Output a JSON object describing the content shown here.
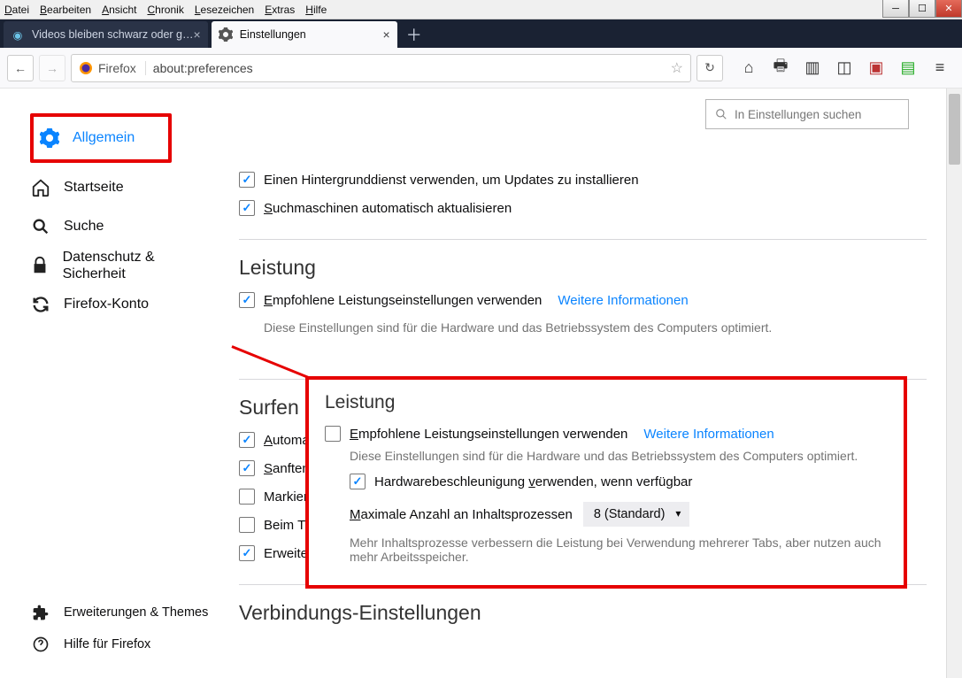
{
  "menubar": [
    "Datei",
    "Bearbeiten",
    "Ansicht",
    "Chronik",
    "Lesezeichen",
    "Extras",
    "Hilfe"
  ],
  "tabs": [
    {
      "title": "Videos bleiben schwarz oder g…",
      "favicon_color": "#2aa3c9"
    },
    {
      "title": "Einstellungen",
      "favicon_color": "#555"
    }
  ],
  "url": {
    "identity": "Firefox",
    "address": "about:preferences"
  },
  "search_placeholder": "In Einstellungen suchen",
  "sidebar": {
    "items": [
      {
        "label": "Allgemein",
        "icon": "gear"
      },
      {
        "label": "Startseite",
        "icon": "home"
      },
      {
        "label": "Suche",
        "icon": "search"
      },
      {
        "label": "Datenschutz & Sicherheit",
        "icon": "lock"
      },
      {
        "label": "Firefox-Konto",
        "icon": "sync"
      }
    ],
    "footer": [
      {
        "label": "Erweiterungen & Themes",
        "icon": "puzzle"
      },
      {
        "label": "Hilfe für Firefox",
        "icon": "help"
      }
    ]
  },
  "top_checks": {
    "c1": "Einen Hintergrunddienst verwenden, um Updates zu installieren",
    "c2": "Suchmaschinen automatisch aktualisieren"
  },
  "perf": {
    "title": "Leistung",
    "recommended": "Empfohlene Leistungseinstellungen verwenden",
    "more": "Weitere Informationen",
    "hint": "Diese Einstellungen sind für die Hardware und das Betriebssystem des Computers optimiert."
  },
  "surfen": {
    "title": "Surfen",
    "auto": "Automatis",
    "smooth": "Sanften B",
    "mark": "Markieren",
    "type": "Beim Tipp",
    "ext": "Erweiteru"
  },
  "callout": {
    "title": "Leistung",
    "recommended": "Empfohlene Leistungseinstellungen verwenden",
    "more": "Weitere Informationen",
    "hint1": "Diese Einstellungen sind für die Hardware und das Betriebssystem des Computers optimiert.",
    "hw": "Hardwarebeschleunigung verwenden, wenn verfügbar",
    "max_label": "Maximale Anzahl an Inhaltsprozessen",
    "max_value": "8 (Standard)",
    "hint2": "Mehr Inhaltsprozesse verbessern die Leistung bei Verwendung mehrerer Tabs, aber nutzen auch mehr Arbeitsspeicher."
  },
  "conn_title": "Verbindungs-Einstellungen"
}
